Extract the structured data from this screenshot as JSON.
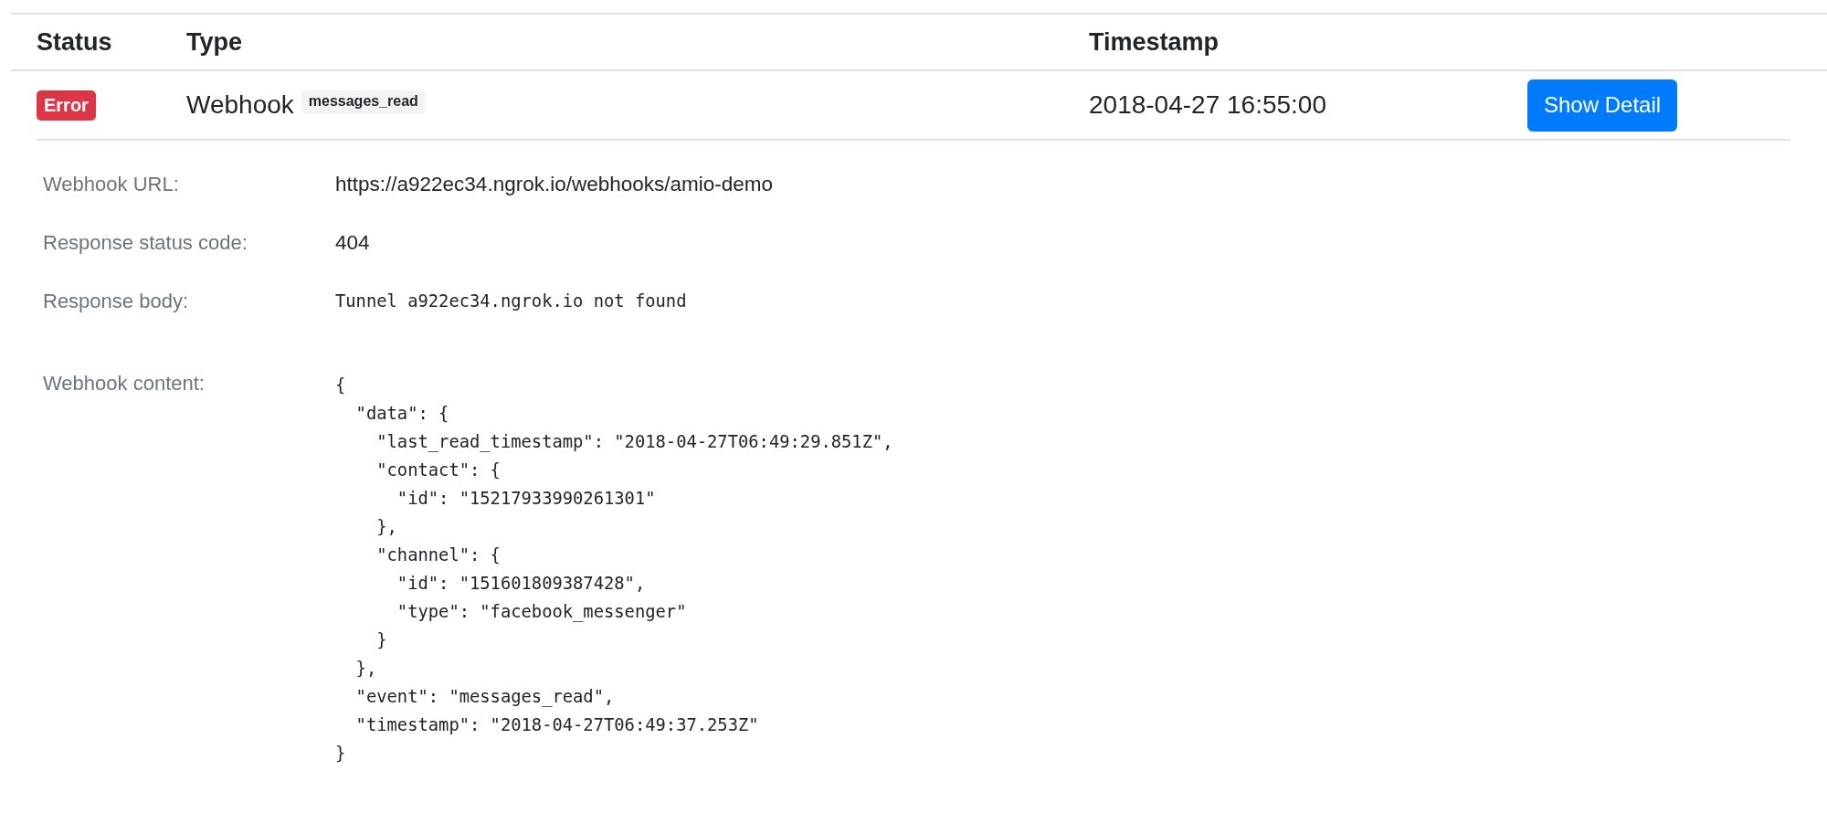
{
  "table": {
    "columns": [
      "Status",
      "Type",
      "Timestamp"
    ],
    "rows": [
      {
        "status": {
          "label": "Error",
          "kind": "danger"
        },
        "type": "Webhook",
        "event_tag": "messages_read",
        "timestamp": "2018-04-27 16:55:00",
        "action": "Show Detail",
        "expanded": true,
        "detail": [
          {
            "label": "Webhook URL:",
            "value": "https://a922ec34.ngrok.io/webhooks/amio-demo",
            "kind": "text"
          },
          {
            "label": "Response status code:",
            "value": "404",
            "kind": "text"
          },
          {
            "label": "Response body:",
            "value": "Tunnel a922ec34.ngrok.io not found",
            "kind": "code"
          },
          {
            "label": "Webhook content:",
            "value": "{\n  \"data\": {\n    \"last_read_timestamp\": \"2018-04-27T06:49:29.851Z\",\n    \"contact\": {\n      \"id\": \"15217933990261301\"\n    },\n    \"channel\": {\n      \"id\": \"151601809387428\",\n      \"type\": \"facebook_messenger\"\n    }\n  },\n  \"event\": \"messages_read\",\n  \"timestamp\": \"2018-04-27T06:49:37.253Z\"\n}",
            "kind": "json"
          }
        ]
      }
    ]
  }
}
